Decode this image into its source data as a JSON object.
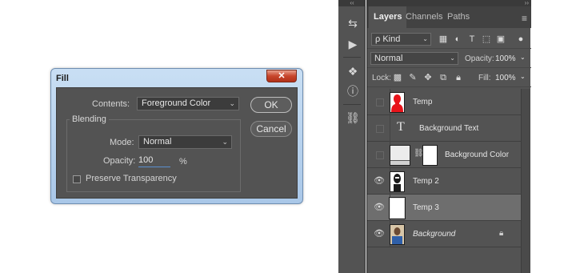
{
  "fill_dialog": {
    "title": "Fill",
    "close_label": "✕",
    "contents_label": "Contents:",
    "contents_value": "Foreground Color",
    "ok_label": "OK",
    "cancel_label": "Cancel",
    "blending_title": "Blending",
    "mode_label": "Mode:",
    "mode_value": "Normal",
    "opacity_label": "Opacity:",
    "opacity_value": "100",
    "opacity_unit": "%",
    "preserve_label": "Preserve Transparency"
  },
  "layers_panel": {
    "tabs": [
      "Layers",
      "Channels",
      "Paths"
    ],
    "kind_filter": "ρ Kind",
    "blend_mode": "Normal",
    "opacity_label": "Opacity:",
    "opacity_value": "100%",
    "lock_label": "Lock:",
    "fill_label": "Fill:",
    "fill_value": "100%",
    "layers": [
      {
        "name": "Temp",
        "visible": false
      },
      {
        "name": "Background Text",
        "visible": false
      },
      {
        "name": "Background Color",
        "visible": false
      },
      {
        "name": "Temp 2",
        "visible": true
      },
      {
        "name": "Temp 3",
        "visible": true,
        "selected": true
      },
      {
        "name": "Background",
        "visible": true,
        "locked": true
      }
    ]
  },
  "colors": {
    "panel_bg": "#535353",
    "selected_layer": "#6e6e6e",
    "dialog_frame": "#b7d0ec",
    "close_button": "#c7452b",
    "temp_thumb": "#e8141b"
  }
}
